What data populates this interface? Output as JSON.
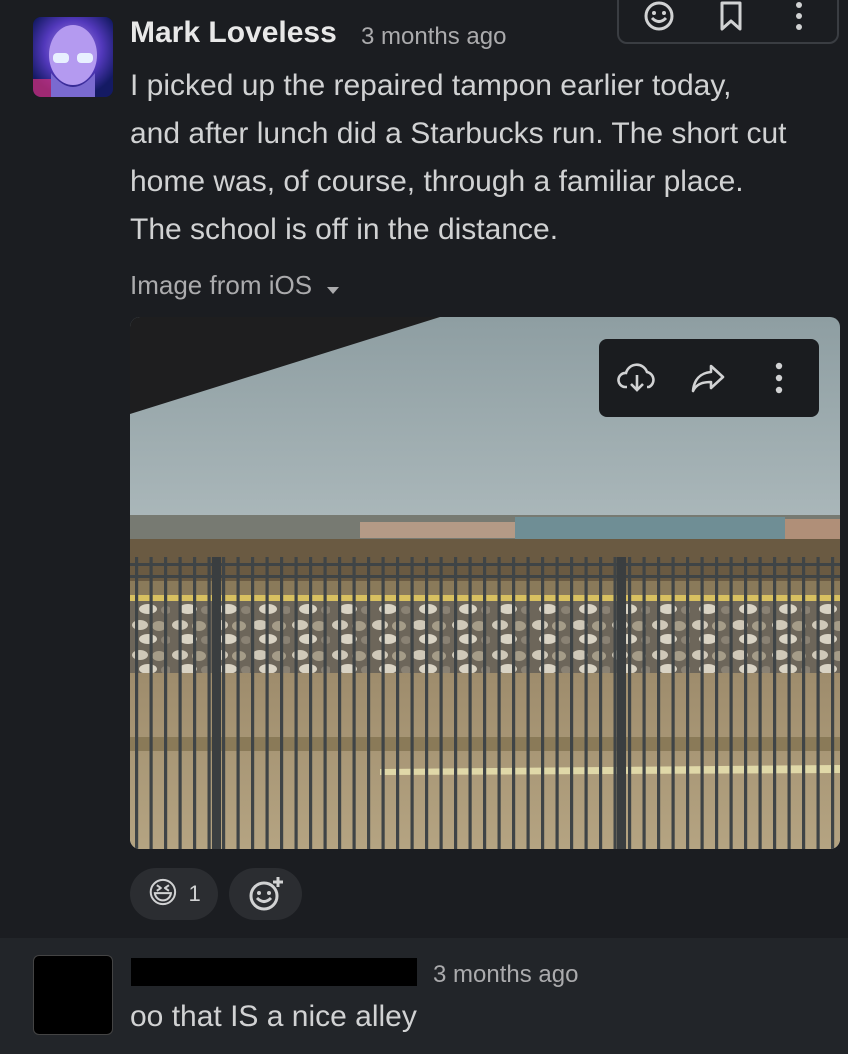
{
  "message": {
    "author": "Mark Loveless",
    "timestamp": "3 months ago",
    "lines": [
      "I picked up the repaired tampon earlier today,",
      "and after lunch did a Starbucks run. The short cut",
      "home was, of course, through a familiar place.",
      "The school is off in the distance."
    ],
    "attachment_label": "Image from iOS",
    "reactions": [
      {
        "emoji": "😆",
        "count": "1"
      }
    ]
  },
  "reply": {
    "timestamp": "3 months ago",
    "text": "oo that IS a nice alley"
  },
  "icons": {
    "toolbar": [
      "add-reaction-icon",
      "bookmark-icon",
      "more-actions-icon"
    ],
    "image_actions": [
      "download-icon",
      "share-icon",
      "more-icon"
    ]
  }
}
